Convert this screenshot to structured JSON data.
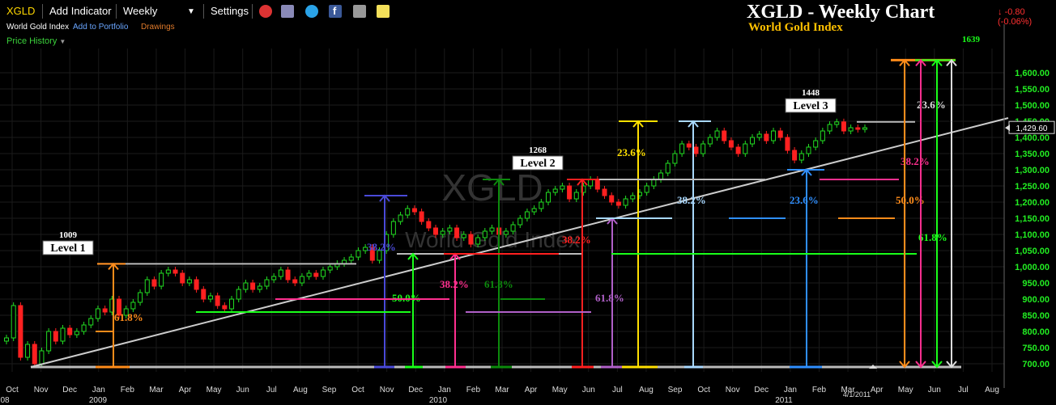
{
  "toolbar": {
    "symbol": "XGLD",
    "add_indicator": "Add Indicator",
    "period": "Weekly",
    "settings": "Settings",
    "icons": [
      "alarm-icon",
      "layers-icon",
      "twitter-icon",
      "facebook-icon",
      "camera-icon",
      "note-icon"
    ]
  },
  "sub": {
    "index_name": "World Gold Index",
    "add_portfolio": "Add to Portfolio",
    "drawings": "Drawings",
    "price_history": "Price History"
  },
  "header": {
    "title": "XGLD - Weekly Chart",
    "subtitle": "World Gold Index",
    "change": "-0.80 (-0.06%)"
  },
  "colors": {
    "up": "#22dd22",
    "down": "#ff2020",
    "axis_text": "#22ee22",
    "orange": "#ff8c1a",
    "blue": "#4a4ad8",
    "pink": "#ff2f8f",
    "green": "#1aff1a",
    "darkgreen": "#0c8a0c",
    "red": "#ff2020",
    "purple": "#b060c8",
    "yellow": "#ffe000",
    "lightblue": "#a8d8ff",
    "azure": "#2f8fff",
    "white": "#dddddd"
  },
  "chart_data": {
    "type": "candlestick",
    "title": "XGLD - Weekly Chart",
    "subtitle": "World Gold Index",
    "watermark": [
      "XGLD",
      "World Gold Index"
    ],
    "ylim": [
      675,
      1675
    ],
    "y_ticks": [
      700,
      750,
      800,
      850,
      900,
      950,
      1000,
      1050,
      1100,
      1150,
      1200,
      1250,
      1300,
      1350,
      1400,
      1450,
      1500,
      1550,
      1600
    ],
    "y_tick_labels": [
      "700.00",
      "750.00",
      "800.00",
      "850.00",
      "900.00",
      "950.00",
      "1,000.00",
      "1,050.00",
      "1,100.00",
      "1,150.00",
      "1,200.00",
      "1,250.00",
      "1,300.00",
      "1,350.00",
      "1,400.00",
      "1,450.00",
      "1,500.00",
      "1,550.00",
      "1,600.00"
    ],
    "last_price": 1429.6,
    "last_price_label": "1,429.60",
    "x_months": [
      "Oct",
      "Nov",
      "Dec",
      "Jan",
      "Feb",
      "Mar",
      "Apr",
      "May",
      "Jun",
      "Jul",
      "Aug",
      "Sep",
      "Oct",
      "Nov",
      "Dec",
      "Jan",
      "Feb",
      "Mar",
      "Apr",
      "May",
      "Jun",
      "Jul",
      "Aug",
      "Sep",
      "Oct",
      "Nov",
      "Dec",
      "Jan",
      "Feb",
      "Mar",
      "Apr",
      "May",
      "Jun",
      "Jul",
      "Aug"
    ],
    "x_years": [
      "08",
      "2009",
      "2010",
      "2011"
    ],
    "x_date_label": "4/1/2011",
    "closes": [
      780,
      880,
      720,
      760,
      700,
      740,
      800,
      770,
      810,
      790,
      800,
      820,
      840,
      870,
      860,
      900,
      850,
      870,
      890,
      920,
      960,
      940,
      980,
      990,
      980,
      950,
      960,
      930,
      900,
      910,
      880,
      870,
      900,
      930,
      950,
      930,
      940,
      960,
      970,
      990,
      960,
      950,
      970,
      980,
      970,
      990,
      1000,
      1010,
      1020,
      1030,
      1050,
      1060,
      1020,
      1050,
      1100,
      1140,
      1160,
      1180,
      1170,
      1140,
      1120,
      1100,
      1110,
      1120,
      1090,
      1100,
      1070,
      1090,
      1110,
      1120,
      1100,
      1110,
      1130,
      1150,
      1170,
      1180,
      1200,
      1230,
      1240,
      1250,
      1210,
      1230,
      1250,
      1270,
      1240,
      1220,
      1200,
      1190,
      1210,
      1220,
      1230,
      1250,
      1270,
      1290,
      1320,
      1350,
      1380,
      1370,
      1350,
      1380,
      1400,
      1420,
      1390,
      1370,
      1350,
      1380,
      1400,
      1410,
      1390,
      1420,
      1400,
      1360,
      1330,
      1350,
      1370,
      1390,
      1420,
      1440,
      1448,
      1420,
      1430,
      1425,
      1430
    ],
    "annotations": {
      "levels": [
        {
          "label": "Level 1",
          "value": 1009
        },
        {
          "label": "Level 2",
          "value": 1268
        },
        {
          "label": "Level 3",
          "value": 1448
        }
      ],
      "projection_high": 1639,
      "fib_labels": [
        {
          "text": "61.8%",
          "color": "orange"
        },
        {
          "text": "38.2%",
          "color": "blue"
        },
        {
          "text": "50.0%",
          "color": "green"
        },
        {
          "text": "38.2%",
          "color": "pink"
        },
        {
          "text": "61.8%",
          "color": "darkgreen"
        },
        {
          "text": "38.2%",
          "color": "red"
        },
        {
          "text": "61.8%",
          "color": "purple"
        },
        {
          "text": "23.6%",
          "color": "yellow"
        },
        {
          "text": "38.2%",
          "color": "lightblue"
        },
        {
          "text": "23.6%",
          "color": "azure"
        },
        {
          "text": "23.6%",
          "color": "white"
        },
        {
          "text": "38.2%",
          "color": "pink"
        },
        {
          "text": "50.0%",
          "color": "orange"
        },
        {
          "text": "61.8%",
          "color": "green"
        }
      ]
    }
  }
}
